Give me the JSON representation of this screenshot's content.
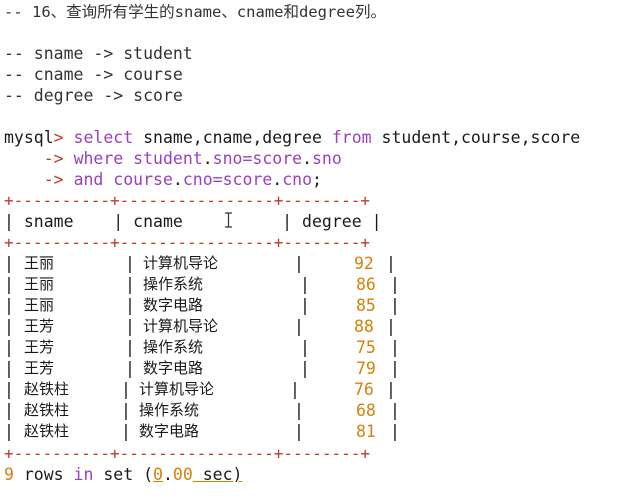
{
  "comments": {
    "title": "-- 16、查询所有学生的sname、cname和degree列。",
    "map1": "-- sname -> student",
    "map2": "-- cname -> course",
    "map3": "-- degree -> score"
  },
  "query": {
    "prompt": "mysql",
    "prompt_gt": ">",
    "kw_select": "select",
    "cols": " sname,cname,degree ",
    "kw_from": "from",
    "tables": " student,course,score",
    "cont": "->",
    "kw_where": "where",
    "cond1_a": " student",
    "cond1_dot": ".",
    "cond1_b": "sno=score",
    "cond1_dot2": ".",
    "cond1_c": "sno",
    "kw_and": "and",
    "cond2_a": " course",
    "cond2_dot": ".",
    "cond2_b": "cno=score",
    "cond2_dot2": ".",
    "cond2_c": "cno",
    "semicolon": ";"
  },
  "table": {
    "border": "+----------+----------------+--------+",
    "headers": [
      "sname",
      "cname",
      "degree"
    ],
    "rows": [
      {
        "sname": "王丽",
        "cname": "计算机导论",
        "degree": "92"
      },
      {
        "sname": "王丽",
        "cname": "操作系统",
        "degree": "86"
      },
      {
        "sname": "王丽",
        "cname": "数字电路",
        "degree": "85"
      },
      {
        "sname": "王芳",
        "cname": "计算机导论",
        "degree": "88"
      },
      {
        "sname": "王芳",
        "cname": "操作系统",
        "degree": "75"
      },
      {
        "sname": "王芳",
        "cname": "数字电路",
        "degree": "79"
      },
      {
        "sname": "赵铁柱",
        "cname": "计算机导论",
        "degree": "76"
      },
      {
        "sname": "赵铁柱",
        "cname": "操作系统",
        "degree": "68"
      },
      {
        "sname": "赵铁柱",
        "cname": "数字电路",
        "degree": "81"
      }
    ]
  },
  "footer": {
    "count": "9",
    "text1": " rows ",
    "kw_in": "in",
    "text2": " set (",
    "time_int": "0",
    "time_dot": ".",
    "time_frac": "00",
    "text3": " sec)"
  },
  "colors": {
    "keyword": "#9b3fbf",
    "border": "#c0392b",
    "number": "#d4820a"
  }
}
